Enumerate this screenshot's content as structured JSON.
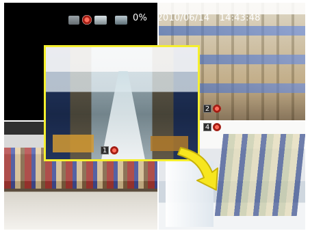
{
  "status": {
    "percent": "0%",
    "date": "2010/06/14",
    "time": "14:43:48",
    "icons": [
      "camera-icon",
      "record-icon",
      "hdd-icon",
      "network-icon"
    ]
  },
  "channels": [
    {
      "label": "1",
      "state_icon": "record-icon"
    },
    {
      "label": "2",
      "state_icon": "record-icon"
    },
    {
      "label": "4",
      "state_icon": "record-icon"
    }
  ],
  "colors": {
    "highlight_border": "#f5ef2e",
    "arrow_fill": "#f7e61f",
    "arrow_stroke": "#c8b20a"
  }
}
